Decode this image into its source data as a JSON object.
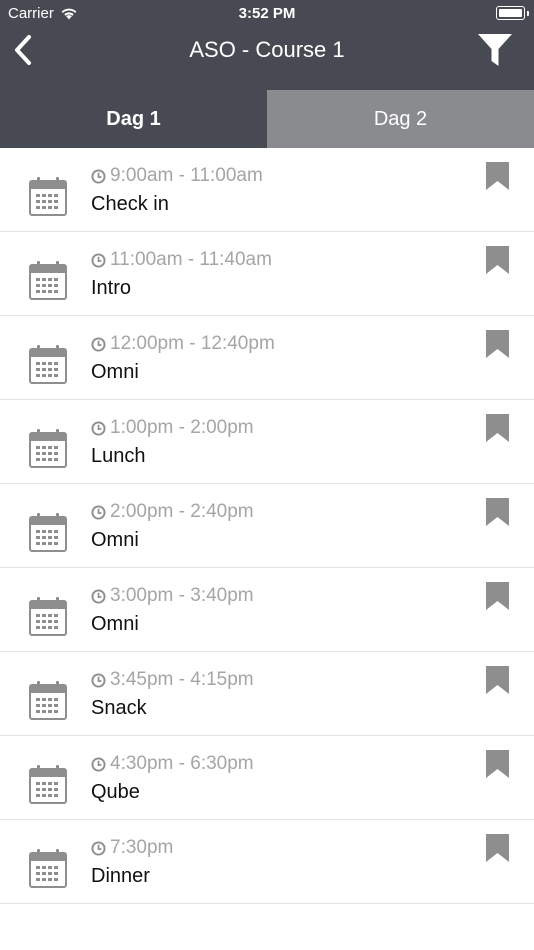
{
  "status_bar": {
    "carrier": "Carrier",
    "time": "3:52 PM"
  },
  "nav": {
    "title": "ASO - Course 1",
    "back_icon": "chevron-left-icon",
    "filter_icon": "filter-icon"
  },
  "tabs": [
    {
      "label": "Dag 1",
      "active": true
    },
    {
      "label": "Dag 2",
      "active": false
    }
  ],
  "colors": {
    "header": "#474a52",
    "tab_inactive": "#898b8f",
    "muted_text": "#a5a5a5",
    "icon_gray": "#8e8e8e"
  },
  "sessions": [
    {
      "time": "9:00am - 11:00am",
      "title": "Check in"
    },
    {
      "time": "11:00am - 11:40am",
      "title": "Intro"
    },
    {
      "time": "12:00pm - 12:40pm",
      "title": "Omni"
    },
    {
      "time": "1:00pm - 2:00pm",
      "title": "Lunch"
    },
    {
      "time": "2:00pm - 2:40pm",
      "title": "Omni"
    },
    {
      "time": "3:00pm - 3:40pm",
      "title": "Omni"
    },
    {
      "time": "3:45pm - 4:15pm",
      "title": "Snack"
    },
    {
      "time": "4:30pm - 6:30pm",
      "title": "Qube"
    },
    {
      "time": "7:30pm",
      "title": "Dinner"
    }
  ]
}
